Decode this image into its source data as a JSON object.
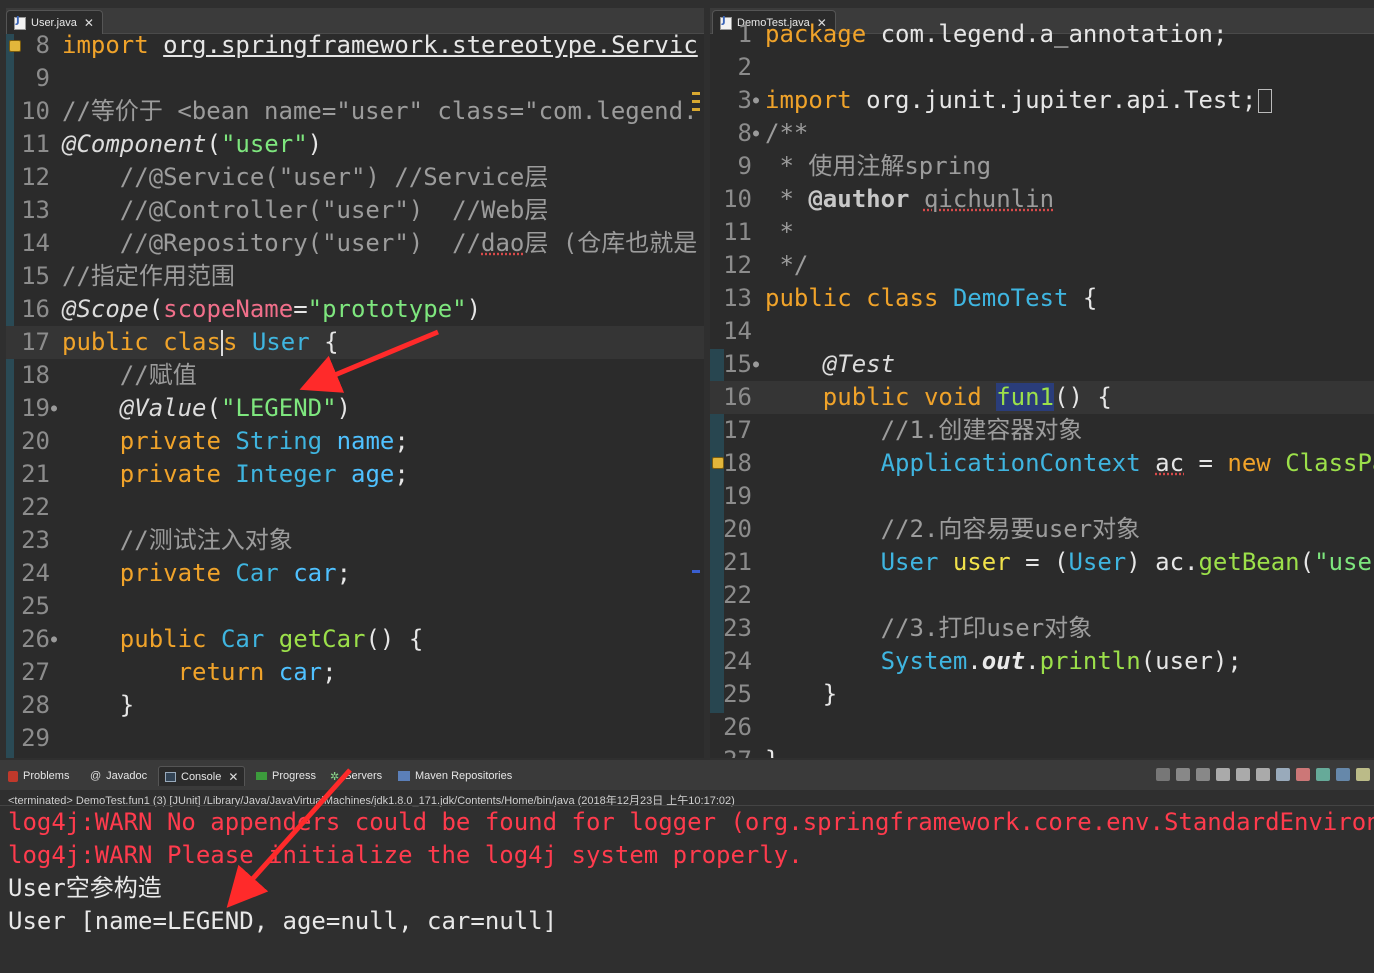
{
  "left_editor": {
    "tab_label": "User.java",
    "lines": [
      {
        "n": "8",
        "html": "<span class='kw'>import</span> <span class='uline'>org.springframework.stereotype.Servic</span>"
      },
      {
        "n": "9",
        "html": ""
      },
      {
        "n": "10",
        "html": "<span class='cm'>//等价于 &lt;bean name=\"user\" class=\"com.legend.</span>"
      },
      {
        "n": "11",
        "html": "<span class='an'>@Component</span>(<span class='str'>\"user\"</span>)"
      },
      {
        "n": "12",
        "html": "    <span class='cm'>//@Service(\"user\") //Service层</span>"
      },
      {
        "n": "13",
        "html": "    <span class='cm'>//@Controller(\"user\")  //Web层</span>"
      },
      {
        "n": "14",
        "html": "    <span class='cm'>//@Repository(\"user\")  //<span class='squig'>dao</span>层 (仓库也就是</span>"
      },
      {
        "n": "15",
        "html": "<span class='cm'>//指定作用范围</span>"
      },
      {
        "n": "16",
        "html": "<span class='an'>@Scope</span>(<span class='pm'>scopeName</span>=<span class='str'>\"prototype\"</span>)"
      },
      {
        "n": "17",
        "html": "<span class='kw'>public</span> <span class='kw'>clas<span class='cursor'></span>s</span> <span class='ty'>User</span> {",
        "current": true
      },
      {
        "n": "18",
        "html": "    <span class='cm'>//赋值</span>"
      },
      {
        "n": "19",
        "html": "    <span class='an'>@Value</span>(<span class='str'>\"LEGEND\"</span>)",
        "fold": true
      },
      {
        "n": "20",
        "html": "    <span class='kw'>private</span> <span class='ty'>String</span> <span class='fd'>name</span>;"
      },
      {
        "n": "21",
        "html": "    <span class='kw'>private</span> <span class='ty'>Integer</span> <span class='fd'>age</span>;"
      },
      {
        "n": "22",
        "html": ""
      },
      {
        "n": "23",
        "html": "    <span class='cm'>//测试注入对象</span>"
      },
      {
        "n": "24",
        "html": "    <span class='kw'>private</span> <span class='ty'>Car</span> <span class='fd'>car</span>;"
      },
      {
        "n": "25",
        "html": ""
      },
      {
        "n": "26",
        "html": "    <span class='kw'>public</span> <span class='ty'>Car</span> <span class='mt'>getCar</span>() {",
        "fold": true
      },
      {
        "n": "27",
        "html": "        <span class='kw'>return</span> <span class='fd'>car</span>;"
      },
      {
        "n": "28",
        "html": "    }"
      },
      {
        "n": "29",
        "html": ""
      }
    ]
  },
  "right_editor": {
    "tab_label": "DemoTest.java",
    "lines": [
      {
        "n": "1",
        "html": "<span class='kw'>package</span> com.legend.a_annotation;"
      },
      {
        "n": "2",
        "html": ""
      },
      {
        "n": "3",
        "html": "<span class='kw'>import</span> org.junit.jupiter.api.Test;<span class='box'></span>",
        "fold": true
      },
      {
        "n": "8",
        "html": "<span class='jd'>/**</span>",
        "fold": true
      },
      {
        "n": "9",
        "html": " <span class='jd'>* 使用注解spring</span>"
      },
      {
        "n": "10",
        "html": " <span class='jd'>* </span><span class='jdt'>@author</span> <span class='jd squig'>qichunlin</span>"
      },
      {
        "n": "11",
        "html": " <span class='jd'>*</span>"
      },
      {
        "n": "12",
        "html": " <span class='jd'>*/</span>"
      },
      {
        "n": "13",
        "html": "<span class='kw'>public</span> <span class='kw'>class</span> <span class='ty'>DemoTest</span> {"
      },
      {
        "n": "14",
        "html": ""
      },
      {
        "n": "15",
        "html": "    <span class='an'>@Test</span>",
        "fold": true
      },
      {
        "n": "16",
        "html": "    <span class='kw'>public</span> <span class='kw'>void</span> <span class='mt hl'>fun1</span>() {",
        "current": true
      },
      {
        "n": "17",
        "html": "        <span class='cm'>//1.创建容器对象</span>"
      },
      {
        "n": "18",
        "html": "        <span class='ty'>ApplicationContext</span> <span class='squig'>ac</span> = <span class='kw'>new</span> <span class='mt'>ClassPa</span>"
      },
      {
        "n": "19",
        "html": ""
      },
      {
        "n": "20",
        "html": "        <span class='cm'>//2.向容易要user对象</span>"
      },
      {
        "n": "21",
        "html": "        <span class='ty'>User</span> <span class='pm' style='color:#f0e14a'>user</span> = (<span class='ty'>User</span>) ac.<span class='mt'>getBean</span>(<span class='str'>\"use</span>"
      },
      {
        "n": "22",
        "html": ""
      },
      {
        "n": "23",
        "html": "        <span class='cm'>//3.打印user对象</span>"
      },
      {
        "n": "24",
        "html": "        <span class='ty'>System</span>.<span class='stat'>out</span>.<span class='mt'>println</span>(user);"
      },
      {
        "n": "25",
        "html": "    }"
      },
      {
        "n": "26",
        "html": ""
      },
      {
        "n": "27",
        "html": "}"
      }
    ]
  },
  "console": {
    "tabs": {
      "problems": "Problems",
      "javadoc": "Javadoc",
      "console": "Console",
      "progress": "Progress",
      "servers": "Servers",
      "maven": "Maven Repositories"
    },
    "status": "<terminated> DemoTest.fun1 (3) [JUnit] /Library/Java/JavaVirtualMachines/jdk1.8.0_171.jdk/Contents/Home/bin/java (2018年12月23日 上午10:17:02)",
    "lines": [
      {
        "kind": "err",
        "text": "log4j:WARN No appenders could be found for logger (org.springframework.core.env.StandardEnviron"
      },
      {
        "kind": "err",
        "text": "log4j:WARN Please initialize the log4j system properly."
      },
      {
        "kind": "out",
        "text": "User空参构造"
      },
      {
        "kind": "out",
        "text": "User [name=LEGEND, age=null, car=null]"
      }
    ]
  },
  "colors": {
    "keyword": "#f0a32a",
    "type": "#3fb5e0",
    "string": "#7ee67e",
    "comment": "#9c9c9c",
    "error": "#ff3b4d",
    "arrow": "#ff2a2a"
  }
}
